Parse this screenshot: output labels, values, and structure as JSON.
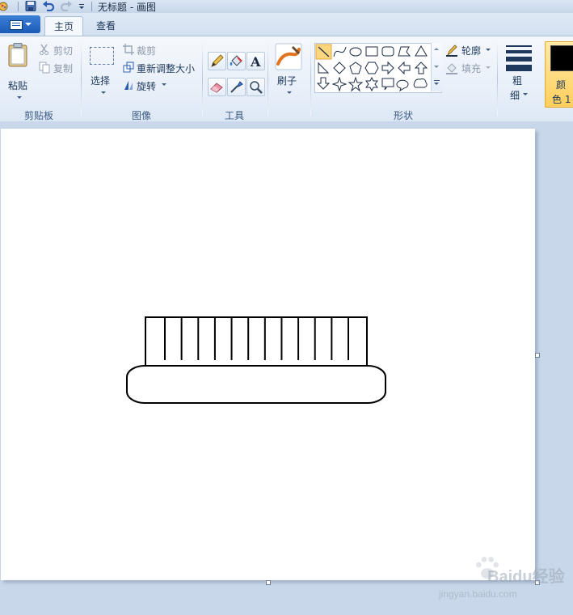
{
  "window": {
    "title": "无标题 - 画图"
  },
  "tabs": [
    {
      "label": "主页",
      "active": true
    },
    {
      "label": "查看",
      "active": false
    }
  ],
  "clipboard": {
    "paste_label": "粘贴",
    "cut_label": "剪切",
    "copy_label": "复制",
    "group_label": "剪贴板"
  },
  "image": {
    "select_label": "选择",
    "crop_label": "裁剪",
    "resize_label": "重新调整大小",
    "rotate_label": "旋转",
    "group_label": "图像"
  },
  "tools": {
    "group_label": "工具",
    "items": [
      "pencil-icon",
      "fill-bucket-icon",
      "text-icon",
      "eraser-icon",
      "color-picker-icon",
      "magnifier-icon"
    ]
  },
  "brushes": {
    "label": "刷子"
  },
  "shapes": {
    "group_label": "形状",
    "outline_label": "轮廓",
    "fill_label": "填充",
    "items": [
      "line-icon",
      "curve-icon",
      "oval-icon",
      "rectangle-icon",
      "rounded-rectangle-icon",
      "polygon-icon",
      "triangle-icon",
      "right-triangle-icon",
      "diamond-icon",
      "pentagon-icon",
      "hexagon-icon",
      "right-arrow-icon",
      "left-arrow-icon",
      "up-arrow-icon",
      "down-arrow-icon",
      "four-point-star-icon",
      "five-point-star-icon",
      "six-point-star-icon",
      "rect-callout-icon",
      "oval-callout-icon",
      "cloud-callout-icon"
    ]
  },
  "size": {
    "label_line1": "粗",
    "label_line2": "细"
  },
  "color1": {
    "label_line1": "颜",
    "label_line2": "色 1",
    "value": "#000000"
  },
  "drawing": {
    "stroke": "#000000",
    "vertical_bar_count": 12
  },
  "watermark": {
    "brand": "Baidu经验",
    "url": "jingyan.baidu.com"
  }
}
